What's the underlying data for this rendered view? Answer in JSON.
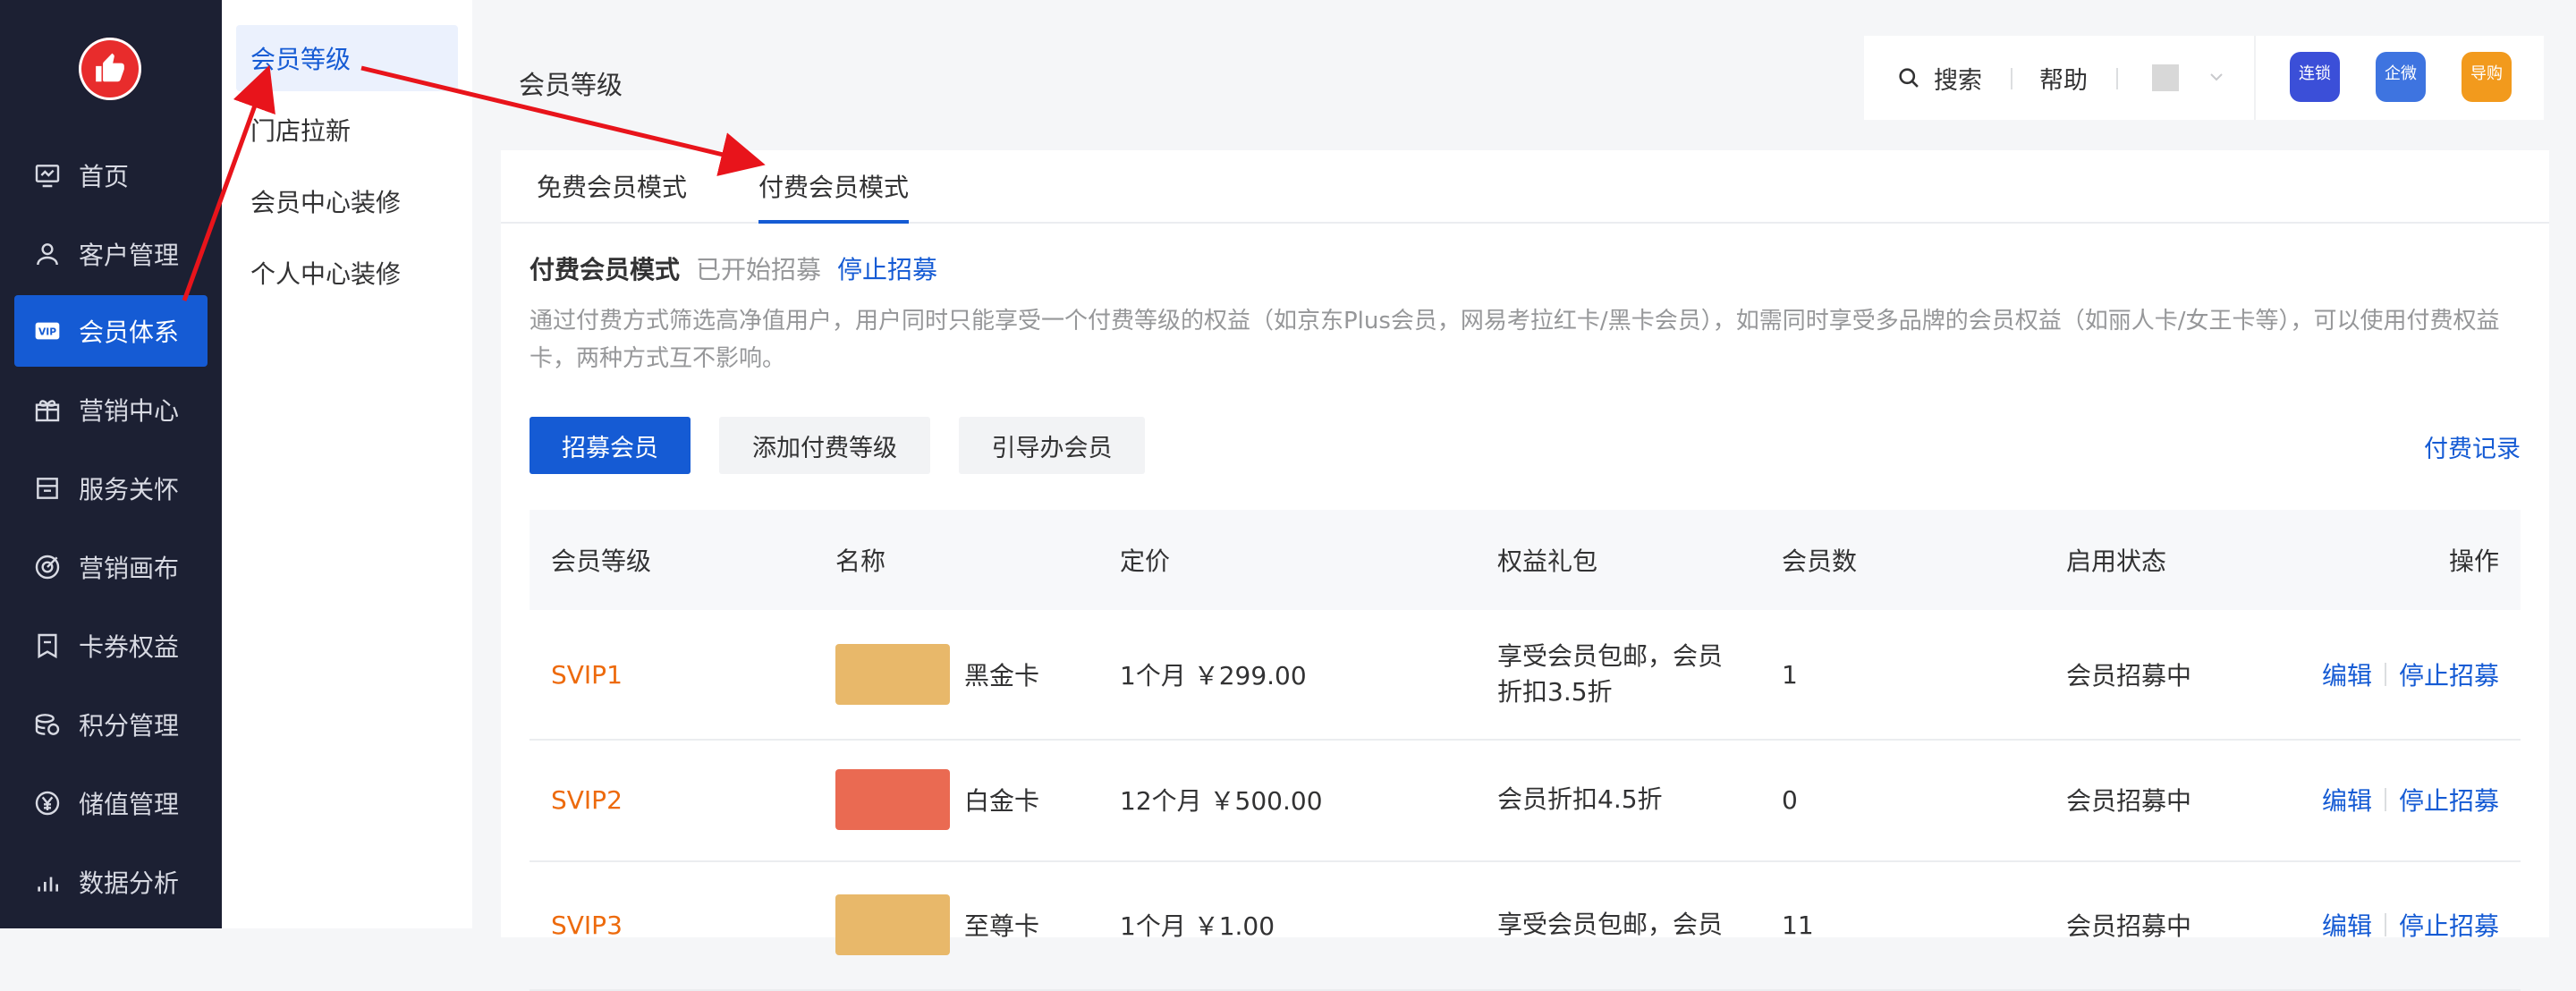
{
  "sidebar": {
    "items": [
      {
        "label": "首页",
        "icon": "home-monitor-icon"
      },
      {
        "label": "客户管理",
        "icon": "user-icon"
      },
      {
        "label": "会员体系",
        "icon": "vip-icon"
      },
      {
        "label": "营销中心",
        "icon": "gift-icon"
      },
      {
        "label": "服务关怀",
        "icon": "service-box-icon"
      },
      {
        "label": "营销画布",
        "icon": "target-icon"
      },
      {
        "label": "卡券权益",
        "icon": "coupon-icon"
      },
      {
        "label": "积分管理",
        "icon": "coins-icon"
      },
      {
        "label": "储值管理",
        "icon": "yen-icon"
      },
      {
        "label": "数据分析",
        "icon": "bar-chart-icon"
      }
    ],
    "active_index": 2,
    "vip_badge": "VIP"
  },
  "subnav": {
    "items": [
      "会员等级",
      "门店拉新",
      "会员中心装修",
      "个人中心装修"
    ],
    "active_index": 0
  },
  "header": {
    "page_title": "会员等级",
    "search_label": "搜索",
    "help_label": "帮助",
    "apps": [
      {
        "label": "连锁",
        "color": "#3b4fd8"
      },
      {
        "label": "企微",
        "color": "#3e74e0"
      },
      {
        "label": "导购",
        "color": "#f29a1d"
      }
    ]
  },
  "tabs": {
    "items": [
      "免费会员模式",
      "付费会员模式"
    ],
    "active_index": 1
  },
  "mode": {
    "title": "付费会员模式",
    "status": "已开始招募",
    "stop_link": "停止招募",
    "description": "通过付费方式筛选高净值用户，用户同时只能享受一个付费等级的权益（如京东Plus会员，网易考拉红卡/黑卡会员），如需同时享受多品牌的会员权益（如丽人卡/女王卡等），可以使用付费权益卡，两种方式互不影响。"
  },
  "actions": {
    "recruit": "招募会员",
    "add_level": "添加付费等级",
    "guide": "引导办会员",
    "pay_record": "付费记录"
  },
  "table": {
    "columns": [
      "会员等级",
      "名称",
      "定价",
      "权益礼包",
      "会员数",
      "启用状态",
      "操作"
    ],
    "rows": [
      {
        "level": "SVIP1",
        "name": "黑金卡",
        "card_color": "#e8b86a",
        "price": "1个月 ￥299.00",
        "benefit": "享受会员包邮，会员折扣3.5折",
        "count": "1",
        "status": "会员招募中",
        "edit": "编辑",
        "stop": "停止招募"
      },
      {
        "level": "SVIP2",
        "name": "白金卡",
        "card_color": "#ea6a52",
        "price": "12个月 ￥500.00",
        "benefit": "会员折扣4.5折",
        "count": "0",
        "status": "会员招募中",
        "edit": "编辑",
        "stop": "停止招募"
      },
      {
        "level": "SVIP3",
        "name": "至尊卡",
        "card_color": "#e8b86a",
        "price": "1个月 ￥1.00",
        "benefit": "享受会员包邮，会员",
        "count": "11",
        "status": "会员招募中",
        "edit": "编辑",
        "stop": "停止招募"
      }
    ]
  },
  "colors": {
    "primary": "#155bd4",
    "sidebar_bg": "#1c2033",
    "level_orange": "#ed6a0c",
    "annotation_arrow": "#e8141b"
  }
}
